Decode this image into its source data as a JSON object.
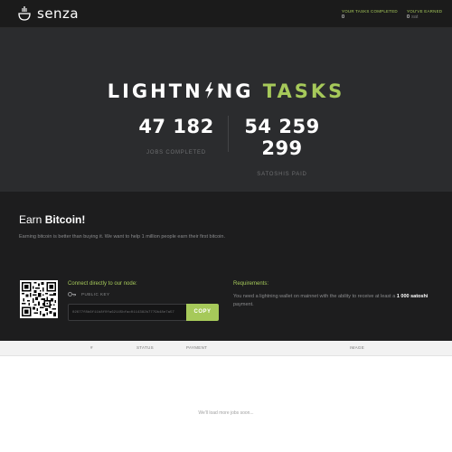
{
  "header": {
    "brand": "senza",
    "tasks_completed_label": "YOUR TASKS COMPLETED",
    "tasks_completed_value": "0",
    "earned_label": "YOU'VE EARNED",
    "earned_value": "0",
    "earned_unit": "sat"
  },
  "hero": {
    "title_part1": "LIGHTN",
    "title_part2": "NG",
    "title_accent": "TASKS",
    "jobs_value": "47 182",
    "jobs_label": "JOBS COMPLETED",
    "satoshis_value": "54 259 299",
    "satoshis_label": "SATOSHIS PAID"
  },
  "earn": {
    "title_prefix": "Earn",
    "title_bold": "Bitcoin!",
    "description": "Earning bitcoin is better than buying it. We want to help 1 million people earn their first bitcoin."
  },
  "connect": {
    "title": "Connect directly to our node:",
    "key_label": "PUBLIC KEY",
    "public_key": "02677f8b6f11b8f0fa62145bfac0114382b7779b48e7a57",
    "copy_label": "COPY"
  },
  "requirements": {
    "title": "Requirements:",
    "text_prefix": "You need a lightning wallet on mainnet with the ability to receive at least a",
    "text_bold": "1 000 satoshi",
    "text_suffix": "payment."
  },
  "table": {
    "columns": [
      "#",
      "STATUS",
      "PAYMENT",
      "IMAGE"
    ]
  },
  "loading_text": "We'll load more jobs soon...",
  "colors": {
    "accent": "#a6c95a",
    "topbar_bg": "#1b1b1b",
    "hero_bg": "#2b2c2e",
    "earn_bg": "#1d1d1e"
  }
}
